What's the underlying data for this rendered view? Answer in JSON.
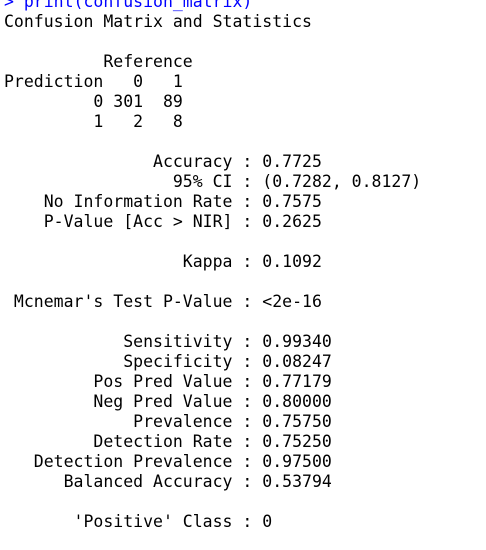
{
  "console": {
    "command": "> print(confusion_matrix)",
    "colors": {
      "command": "#0000ff",
      "output": "#000000",
      "background": "#ffffff"
    },
    "output_lines": [
      "Confusion Matrix and Statistics",
      "",
      "          Reference",
      "Prediction   0   1",
      "         0 301  89",
      "         1   2   8",
      "",
      "               Accuracy : 0.7725",
      "                 95% CI : (0.7282, 0.8127)",
      "    No Information Rate : 0.7575",
      "    P-Value [Acc > NIR] : 0.2625",
      "",
      "                  Kappa : 0.1092",
      "",
      " Mcnemar's Test P-Value : <2e-16",
      "",
      "            Sensitivity : 0.99340",
      "            Specificity : 0.08247",
      "         Pos Pred Value : 0.77179",
      "         Neg Pred Value : 0.80000",
      "             Prevalence : 0.75750",
      "         Detection Rate : 0.75250",
      "   Detection Prevalence : 0.97500",
      "      Balanced Accuracy : 0.53794",
      "",
      "       'Positive' Class : 0"
    ]
  }
}
